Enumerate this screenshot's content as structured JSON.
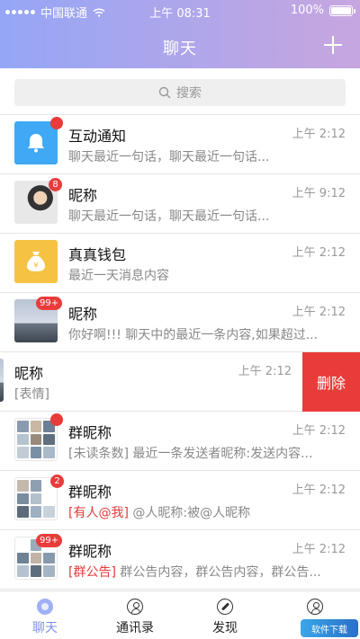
{
  "status_bar": {
    "carrier": "中国联通",
    "time": "上午 08:31",
    "battery": "100%"
  },
  "nav": {
    "title": "聊天"
  },
  "search": {
    "placeholder": "搜索"
  },
  "chats": [
    {
      "name": "互动通知",
      "time": "上午 2:12",
      "message": "聊天最近一句话，聊天最近一句话..."
    },
    {
      "name": "昵称",
      "time": "上午 9:12",
      "message": "聊天最近一句话，聊天最近一句话...",
      "badge": "8"
    },
    {
      "name": "真真钱包",
      "time": "上午 2:12",
      "message": "最近一天消息内容"
    },
    {
      "name": "昵称",
      "time": "上午 2:12",
      "message": "你好啊!!! 聊天中的最近一条内容,如果超过...",
      "badge": "99+"
    },
    {
      "name": "昵称",
      "time": "上午 2:12",
      "message": "[表情]",
      "delete_label": "删除"
    },
    {
      "name": "群昵称",
      "time": "上午 2:12",
      "message": "[未读条数] 最近一条发送者昵称:发送内容..."
    },
    {
      "name": "群昵称",
      "time": "上午 2:12",
      "tag": "[有人@我]",
      "message": "@人昵称:被@人昵称",
      "badge": "2"
    },
    {
      "name": "群昵称",
      "time": "上午 2:12",
      "tag": "[群公告]",
      "message": "群公告内容，群公告内容，群公告...",
      "badge": "99+"
    }
  ],
  "tabs": [
    {
      "label": "聊天",
      "active": true
    },
    {
      "label": "通讯录"
    },
    {
      "label": "发现"
    },
    {
      "label": "我"
    }
  ],
  "watermark": "软件下载"
}
